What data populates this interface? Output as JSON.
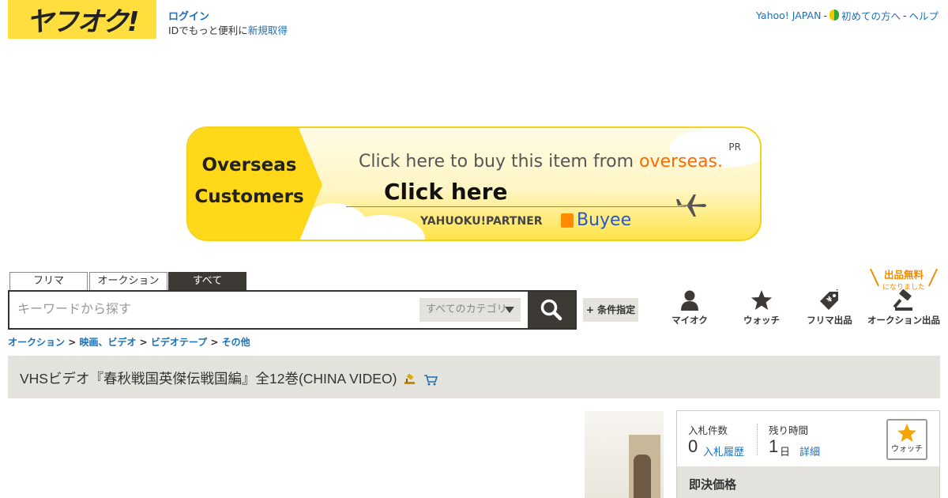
{
  "header": {
    "logo_text": "ヤフオク!",
    "login_label": "ログイン",
    "id_prefix": "IDでもっと便利に",
    "id_link": "新規取得",
    "links": [
      {
        "label": "Yahoo! JAPAN",
        "sep": "-"
      },
      {
        "label": "初めての方へ",
        "sep": "-"
      },
      {
        "label": "ヘルプ",
        "sep": ""
      }
    ]
  },
  "banner": {
    "left_line1": "Overseas",
    "left_line2": "Customers",
    "pr": "PR",
    "line1_prefix": "Click here to buy this item from ",
    "line1_highlight": "overseas.",
    "line2": "Click here",
    "partner": "YAHUOKU!PARTNER",
    "brand": "Buyee"
  },
  "search": {
    "tabs": [
      "フリマ",
      "オークション",
      "すべて"
    ],
    "active_tab": "すべて",
    "placeholder": "キーワードから探す",
    "category": "すべてのカテゴリ",
    "advanced_label": "+ 条件指定"
  },
  "nav": {
    "badge_line1": "出品無料",
    "badge_line2": "になりました",
    "items": [
      {
        "label": "マイオク",
        "icon": "person-icon"
      },
      {
        "label": "ウォッチ",
        "icon": "star-icon"
      },
      {
        "label": "フリマ出品",
        "icon": "tag-icon"
      },
      {
        "label": "オークション出品",
        "icon": "gavel-icon"
      }
    ]
  },
  "breadcrumb": [
    {
      "label": "オークション"
    },
    {
      "label": "映画、ビデオ"
    },
    {
      "label": "ビデオテープ"
    },
    {
      "label": "その他"
    }
  ],
  "breadcrumb_sep": ">",
  "item": {
    "title": "VHSビデオ『春秋戦国英傑伝戦国編』全12巻(CHINA VIDEO)"
  },
  "bid": {
    "bids_label": "入札件数",
    "bids_value": "0",
    "bids_link": "入札履歴",
    "time_label": "残り時間",
    "time_value": "1",
    "time_unit": "日",
    "time_link": "詳細",
    "watch_label": "ウォッチ",
    "buynow_label": "即決価格"
  },
  "colors": {
    "brand_yellow": "#ffde3e",
    "link_blue": "#1b6fb8",
    "dark": "#3d3a36",
    "panel_gray": "#e4e2dc",
    "accent_orange": "#f08c00"
  }
}
